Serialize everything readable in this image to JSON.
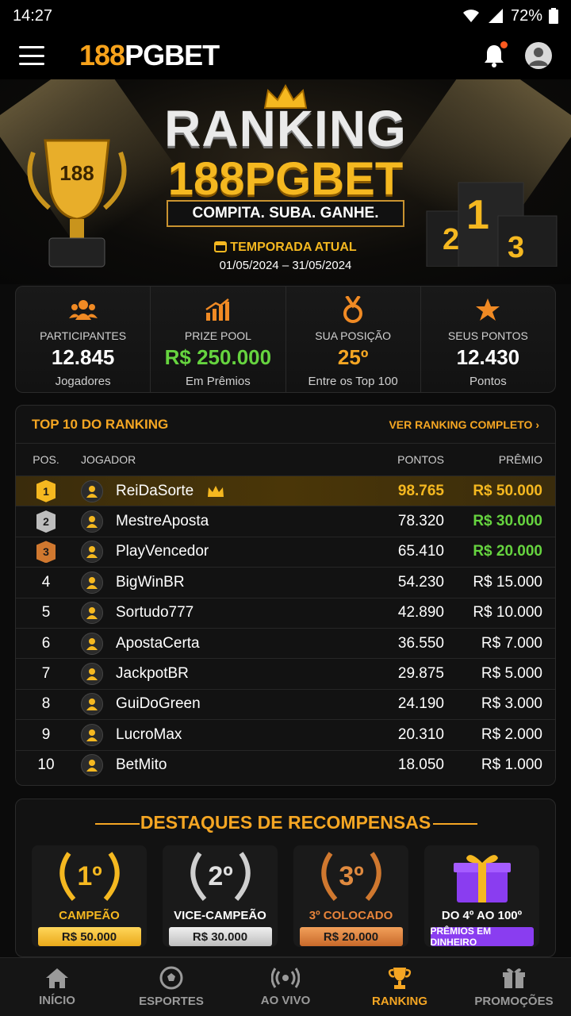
{
  "status": {
    "time": "14:27",
    "battery": "72%"
  },
  "header": {
    "logo_num": "188",
    "logo_text": "PGBET"
  },
  "hero": {
    "title": "RANKING",
    "subtitle": "188PGBET",
    "slogan": "COMPITA. SUBA. GANHE.",
    "season_label": "TEMPORADA ATUAL",
    "season_dates": "01/05/2024 – 31/05/2024",
    "trophy_text": "188",
    "podium": [
      "2",
      "1",
      "3"
    ]
  },
  "stats": [
    {
      "label": "PARTICIPANTES",
      "value": "12.845",
      "note": "Jogadores",
      "icon": "people-icon"
    },
    {
      "label": "PRIZE POOL",
      "value": "R$ 250.000",
      "note": "Em Prêmios",
      "icon": "chart-icon"
    },
    {
      "label": "SUA POSIÇÃO",
      "value": "25º",
      "note": "Entre os Top 100",
      "icon": "medal-icon"
    },
    {
      "label": "SEUS PONTOS",
      "value": "12.430",
      "note": "Pontos",
      "icon": "star-icon"
    }
  ],
  "ranking": {
    "title": "TOP 10 DO RANKING",
    "link": "VER RANKING COMPLETO",
    "columns": {
      "pos": "POS.",
      "player": "JOGADOR",
      "points": "PONTOS",
      "prize": "PRÊMIO"
    },
    "rows": [
      {
        "pos": "1",
        "name": "ReiDaSorte",
        "points": "98.765",
        "prize": "R$ 50.000"
      },
      {
        "pos": "2",
        "name": "MestreAposta",
        "points": "78.320",
        "prize": "R$ 30.000"
      },
      {
        "pos": "3",
        "name": "PlayVencedor",
        "points": "65.410",
        "prize": "R$ 20.000"
      },
      {
        "pos": "4",
        "name": "BigWinBR",
        "points": "54.230",
        "prize": "R$ 15.000"
      },
      {
        "pos": "5",
        "name": "Sortudo777",
        "points": "42.890",
        "prize": "R$ 10.000"
      },
      {
        "pos": "6",
        "name": "ApostaCerta",
        "points": "36.550",
        "prize": "R$ 7.000"
      },
      {
        "pos": "7",
        "name": "JackpotBR",
        "points": "29.875",
        "prize": "R$ 5.000"
      },
      {
        "pos": "8",
        "name": "GuiDoGreen",
        "points": "24.190",
        "prize": "R$ 3.000"
      },
      {
        "pos": "9",
        "name": "LucroMax",
        "points": "20.310",
        "prize": "R$ 2.000"
      },
      {
        "pos": "10",
        "name": "BetMito",
        "points": "18.050",
        "prize": "R$ 1.000"
      }
    ]
  },
  "rewards": {
    "title": "DESTAQUES DE RECOMPENSAS",
    "cards": [
      {
        "badge": "1º",
        "label": "CAMPEÃO",
        "amount": "R$ 50.000"
      },
      {
        "badge": "2º",
        "label": "VICE-CAMPEÃO",
        "amount": "R$ 30.000"
      },
      {
        "badge": "3º",
        "label": "3º COLOCADO",
        "amount": "R$ 20.000"
      },
      {
        "badge": "",
        "label": "DO 4º AO 100º",
        "amount": "PRÊMIOS EM DINHEIRO"
      }
    ]
  },
  "nav": [
    {
      "label": "INÍCIO",
      "icon": "home-icon"
    },
    {
      "label": "ESPORTES",
      "icon": "soccer-ball-icon"
    },
    {
      "label": "AO VIVO",
      "icon": "live-icon"
    },
    {
      "label": "RANKING",
      "icon": "trophy-icon",
      "active": true
    },
    {
      "label": "PROMOÇÕES",
      "icon": "gift-icon"
    }
  ],
  "colors": {
    "accent": "#f5a623",
    "green": "#66d43f",
    "purple": "#8a3df0"
  }
}
